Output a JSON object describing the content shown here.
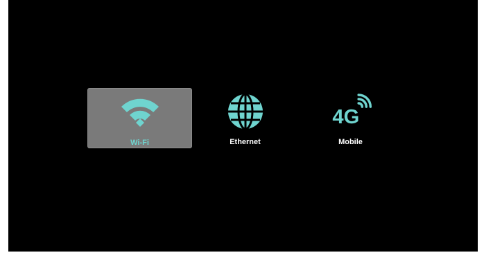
{
  "network_menu": {
    "items": [
      {
        "label": "Wi-Fi",
        "icon": "wifi-icon",
        "selected": true
      },
      {
        "label": "Ethernet",
        "icon": "globe-icon",
        "selected": false
      },
      {
        "label": "Mobile",
        "icon": "4g-signal-icon",
        "selected": false
      }
    ]
  },
  "colors": {
    "background": "#000000",
    "selected_tile": "#7a7a7a",
    "accent": "#6fd4cf",
    "label": "#ffffff"
  },
  "mobile_icon_text": "4G"
}
